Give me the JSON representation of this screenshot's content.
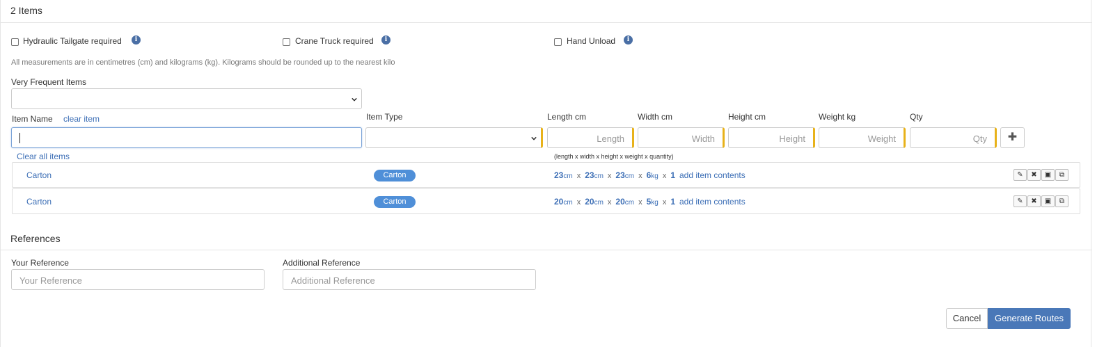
{
  "items_section": {
    "title": "2 Items",
    "options": [
      {
        "label": "Hydraulic Tailgate required",
        "checked": false
      },
      {
        "label": "Crane Truck required",
        "checked": false
      },
      {
        "label": "Hand Unload",
        "checked": false
      }
    ],
    "info_icon": "info-circle-icon",
    "measurement_note": "All measurements are in centimetres (cm) and kilograms (kg). Kilograms should be rounded up to the nearest kilo",
    "frequent_label": "Very Frequent Items",
    "frequent_value": "",
    "item_name_label": "Item Name",
    "clear_item": "clear item",
    "item_name_value": "",
    "item_type_label": "Item Type",
    "item_type_value": "",
    "length_label": "Length cm",
    "width_label": "Width cm",
    "height_label": "Height cm",
    "weight_label": "Weight kg",
    "qty_label": "Qty",
    "length_placeholder": "Length",
    "width_placeholder": "Width",
    "height_placeholder": "Height",
    "weight_placeholder": "Weight",
    "qty_placeholder": "Qty",
    "add_icon": "plus-icon",
    "clear_all": "Clear all items",
    "dims_hint": "(length x  width x  height x  weight x  quantity)",
    "items": [
      {
        "name": "Carton",
        "type": "Carton",
        "length": "23",
        "width": "23",
        "height": "23",
        "weight": "6",
        "qty": "1",
        "contents_link": "add item contents"
      },
      {
        "name": "Carton",
        "type": "Carton",
        "length": "20",
        "width": "20",
        "height": "20",
        "weight": "5",
        "qty": "1",
        "contents_link": "add item contents"
      }
    ],
    "units": {
      "cm": "cm",
      "kg": "kg",
      "x": "x"
    }
  },
  "references": {
    "title": "References",
    "your_reference_label": "Your Reference",
    "your_reference_placeholder": "Your Reference",
    "additional_reference_label": "Additional Reference",
    "additional_reference_placeholder": "Additional Reference"
  },
  "actions": {
    "cancel": "Cancel",
    "generate": "Generate Routes"
  },
  "colors": {
    "accent": "#4a78b8",
    "badge": "#4f8fd8",
    "required_marker": "#e8b21a"
  }
}
